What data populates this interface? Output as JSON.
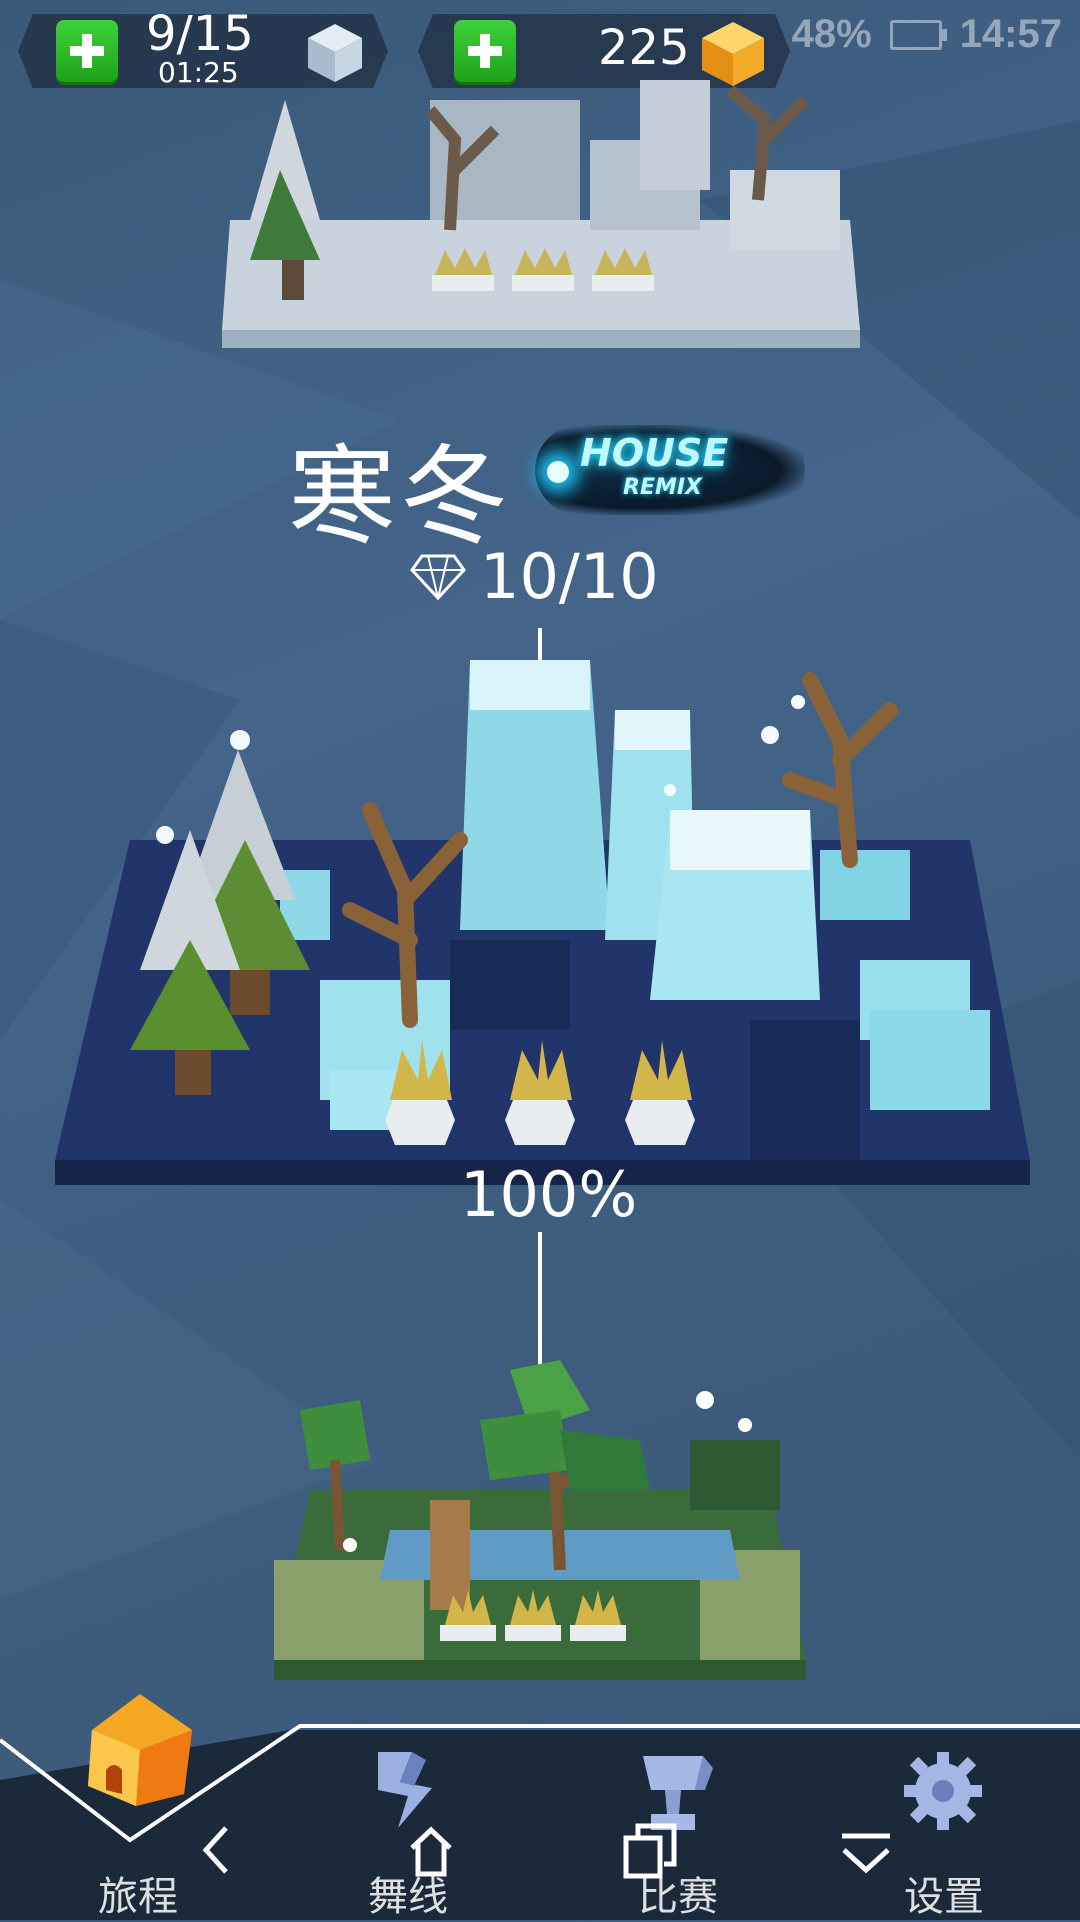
{
  "status_bar": {
    "battery_percent": "48%",
    "time": "14:57"
  },
  "resources": {
    "energy": {
      "count": "9/15",
      "timer": "01:25"
    },
    "gems": {
      "count": "225"
    }
  },
  "level": {
    "title": "寒冬",
    "badge_primary": "HOUSE",
    "badge_secondary": "REMIX",
    "diamonds": "10/10",
    "progress": "100%"
  },
  "bottom_nav": {
    "items": [
      {
        "label": "旅程",
        "icon": "home-icon",
        "active": true
      },
      {
        "label": "舞线",
        "icon": "dance-line-icon",
        "active": false
      },
      {
        "label": "比赛",
        "icon": "trophy-icon",
        "active": false
      },
      {
        "label": "设置",
        "icon": "gear-icon",
        "active": false
      }
    ]
  },
  "colors": {
    "background": "#3f5f80",
    "plus_button": "#2bbf27",
    "gem": "#f5a623",
    "nav_bar": "#1b2a3a",
    "winter_platform": "#1f3263"
  }
}
